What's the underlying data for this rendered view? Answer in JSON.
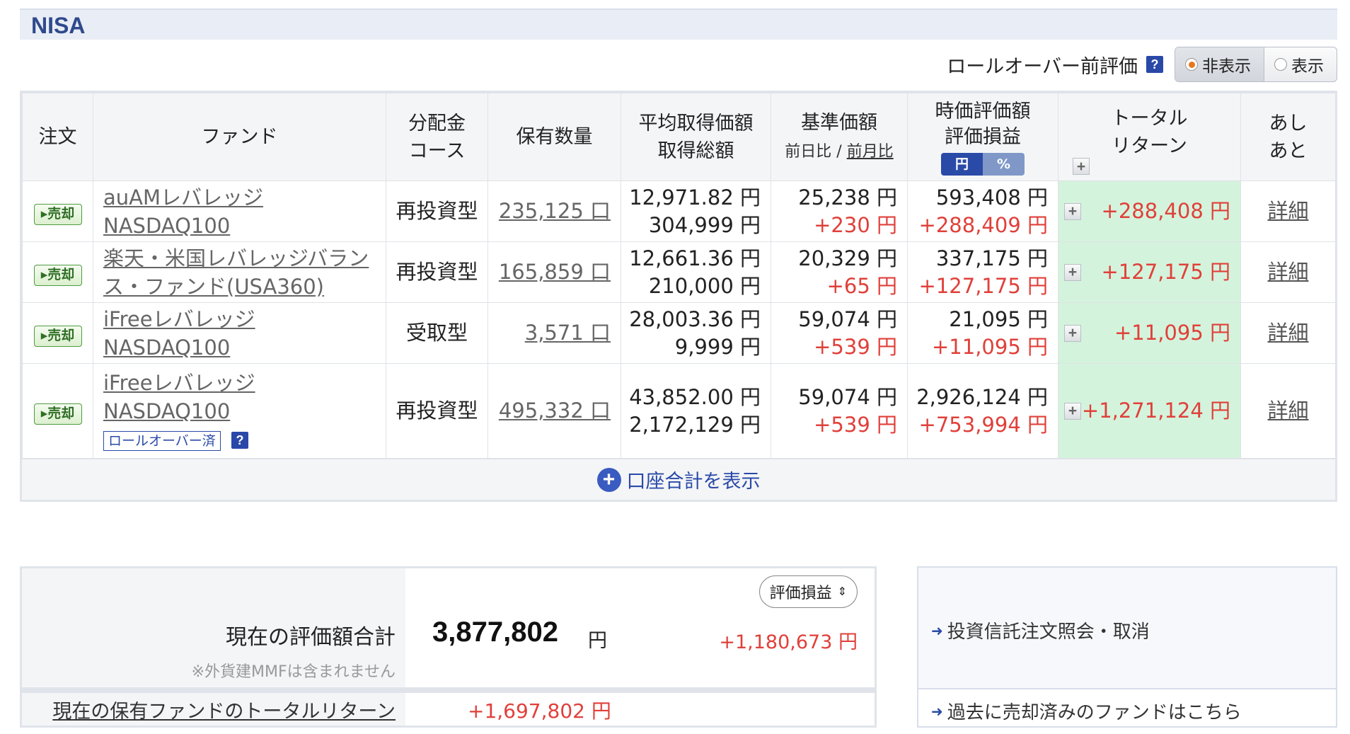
{
  "section": {
    "title": "NISA"
  },
  "rollover": {
    "label": "ロールオーバー前評価",
    "help": "?",
    "options": [
      "非表示",
      "表示"
    ],
    "selected": "非表示"
  },
  "table": {
    "headers": {
      "order": "注文",
      "fund": "ファンド",
      "dividend_1": "分配金",
      "dividend_2": "コース",
      "quantity": "保有数量",
      "avg_cost_1": "平均取得価額",
      "avg_cost_2": "取得総額",
      "base_price": "基準価額",
      "base_prev_day": "前日比",
      "base_sep": "/",
      "base_prev_month": "前月比",
      "market_1": "時価評価額",
      "market_2": "評価損益",
      "unit_yen": "円",
      "unit_pct": "%",
      "total_1": "トータル",
      "total_2": "リターン",
      "history_1": "あし",
      "history_2": "あと",
      "expand": "+"
    },
    "rows": [
      {
        "sell": "売却",
        "fund_line1": "auAMレバレッジ",
        "fund_line2": "NASDAQ100",
        "course": "再投資型",
        "qty": "235,125 口",
        "avg_price": "12,971.82 円",
        "total_cost": "304,999 円",
        "base": "25,238 円",
        "base_change": "+230 円",
        "market": "593,408 円",
        "pl": "+288,409 円",
        "expand": "+",
        "total_return": "+288,408 円",
        "detail": "詳細"
      },
      {
        "sell": "売却",
        "fund_line1": "楽天・米国レバレッジバラン",
        "fund_line2": "ス・ファンド(USA360)",
        "course": "再投資型",
        "qty": "165,859 口",
        "avg_price": "12,661.36 円",
        "total_cost": "210,000 円",
        "base": "20,329 円",
        "base_change": "+65 円",
        "market": "337,175 円",
        "pl": "+127,175 円",
        "expand": "+",
        "total_return": "+127,175 円",
        "detail": "詳細"
      },
      {
        "sell": "売却",
        "fund_line1": "iFreeレバレッジ",
        "fund_line2": "NASDAQ100",
        "course": "受取型",
        "qty": "3,571 口",
        "avg_price": "28,003.36 円",
        "total_cost": "9,999 円",
        "base": "59,074 円",
        "base_change": "+539 円",
        "market": "21,095 円",
        "pl": "+11,095 円",
        "expand": "+",
        "total_return": "+11,095 円",
        "detail": "詳細"
      },
      {
        "sell": "売却",
        "fund_line1": "iFreeレバレッジ",
        "fund_line2": "NASDAQ100",
        "tag": "ロールオーバー済",
        "tag_help": "?",
        "course": "再投資型",
        "qty": "495,332 口",
        "avg_price": "43,852.00 円",
        "total_cost": "2,172,129 円",
        "base": "59,074 円",
        "base_change": "+539 円",
        "market": "2,926,124 円",
        "pl": "+753,994 円",
        "expand": "+",
        "total_return": "+1,271,124 円",
        "detail": "詳細"
      }
    ],
    "show_total": "口座合計を表示",
    "show_total_icon": "+"
  },
  "summary": {
    "label": "現在の評価額合計",
    "note": "※外貨建MMFは含まれません",
    "value": "3,877,802",
    "unit": "円",
    "select": "評価損益",
    "pl": "+1,180,673 円",
    "total_return_label": "現在の保有ファンドのトータルリターン",
    "total_return_value": "+1,697,802 円"
  },
  "links": {
    "order_inquiry": "投資信託注文照会・取消",
    "sold_funds": "過去に売却済みのファンドはこちら",
    "arrow": "➜"
  },
  "colors": {
    "accent": "#2a4aa8",
    "positive": "#e0403a",
    "total_return_bg": "#d4f3dc",
    "header_bg": "#f4f5f7"
  }
}
